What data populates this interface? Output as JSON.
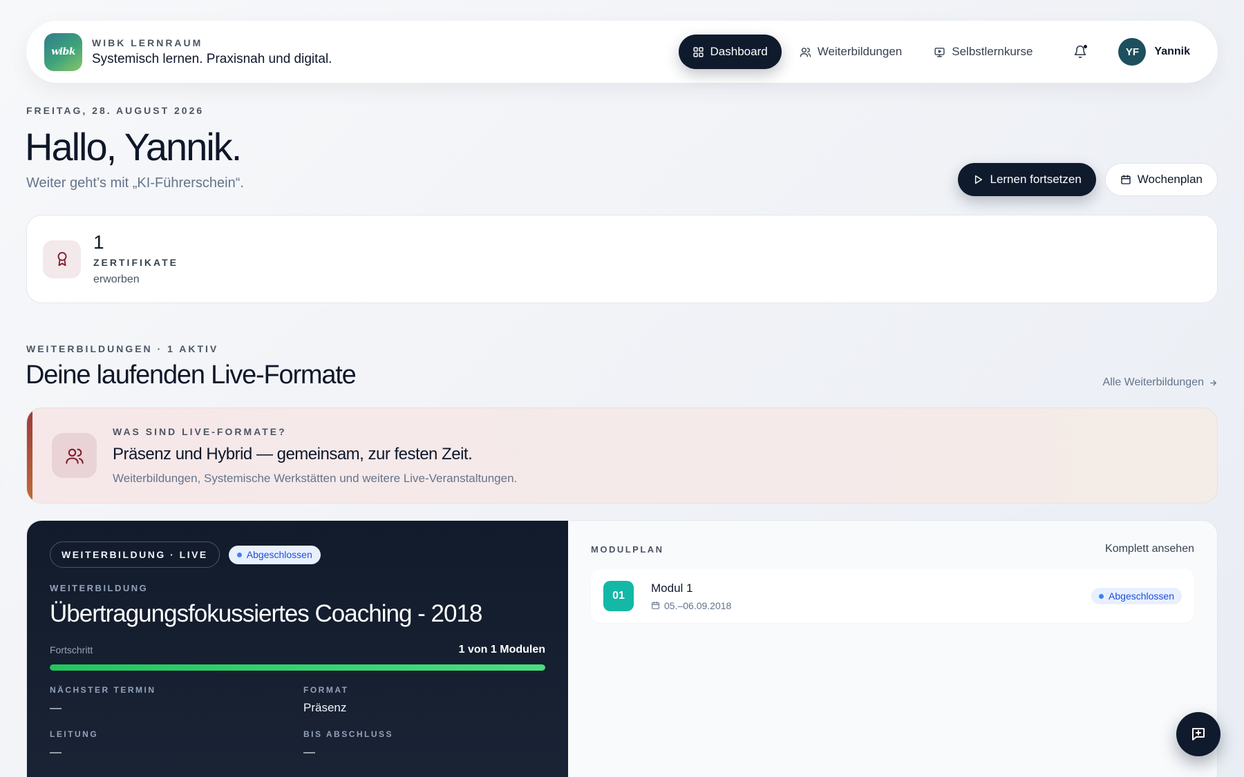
{
  "header": {
    "brand_eyebrow": "WIBK LERNRAUM",
    "brand_tagline": "Systemisch lernen. Praxisnah und digital.",
    "logo_text": "wibk",
    "nav": [
      {
        "label": "Dashboard",
        "icon": "grid-icon",
        "active": true
      },
      {
        "label": "Weiterbildungen",
        "icon": "users-icon",
        "active": false
      },
      {
        "label": "Selbstlernkurse",
        "icon": "monitor-play-icon",
        "active": false
      }
    ],
    "notifications_icon": "bell-icon",
    "user": {
      "initials": "YF",
      "name": "Yannik"
    }
  },
  "greeting": {
    "date": "FREITAG, 28. AUGUST 2026",
    "title": "Hallo, Yannik.",
    "subtitle": "Weiter geht’s mit „KI-Führerschein“."
  },
  "actions": {
    "continue_label": "Lernen fortsetzen",
    "weekplan_label": "Wochenplan"
  },
  "stats": {
    "certificates": {
      "value": "1",
      "label": "ZERTIFIKATE",
      "sub": "erworben",
      "icon": "award-icon"
    }
  },
  "section": {
    "eyebrow": "WEITERBILDUNGEN · 1 AKTIV",
    "title": "Deine laufenden Live-Formate",
    "link": "Alle Weiterbildungen"
  },
  "info": {
    "eyebrow": "WAS SIND LIVE-FORMATE?",
    "title": "Präsenz und Hybrid — gemeinsam, zur festen Zeit.",
    "description": "Weiterbildungen, Systemische Werkstätten und weitere Live-Veranstaltungen."
  },
  "course": {
    "type_chip": "WEITERBILDUNG · LIVE",
    "status": "Abgeschlossen",
    "eyebrow": "WEITERBILDUNG",
    "title": "Übertragungsfokussiertes Coaching - 2018",
    "progress_label": "Fortschritt",
    "progress_value": "1 von 1 Modulen",
    "progress_fraction": 1.0,
    "meta": [
      {
        "key": "NÄCHSTER TERMIN",
        "value": "—"
      },
      {
        "key": "FORMAT",
        "value": "Präsenz"
      },
      {
        "key": "LEITUNG",
        "value": "—"
      },
      {
        "key": "BIS ABSCHLUSS",
        "value": "—"
      }
    ]
  },
  "modulplan": {
    "eyebrow": "MODULPLAN",
    "link": "Komplett ansehen",
    "modules": [
      {
        "number": "01",
        "name": "Modul 1",
        "date": "05.–06.09.2018",
        "status": "Abgeschlossen"
      }
    ]
  },
  "colors": {
    "dark_navy": "#0f1b2d",
    "progress_green": "#22c55e",
    "module_teal": "#14b8a6",
    "status_blue": "#1d4ed8",
    "accent_rose": "#9b3b3b"
  }
}
